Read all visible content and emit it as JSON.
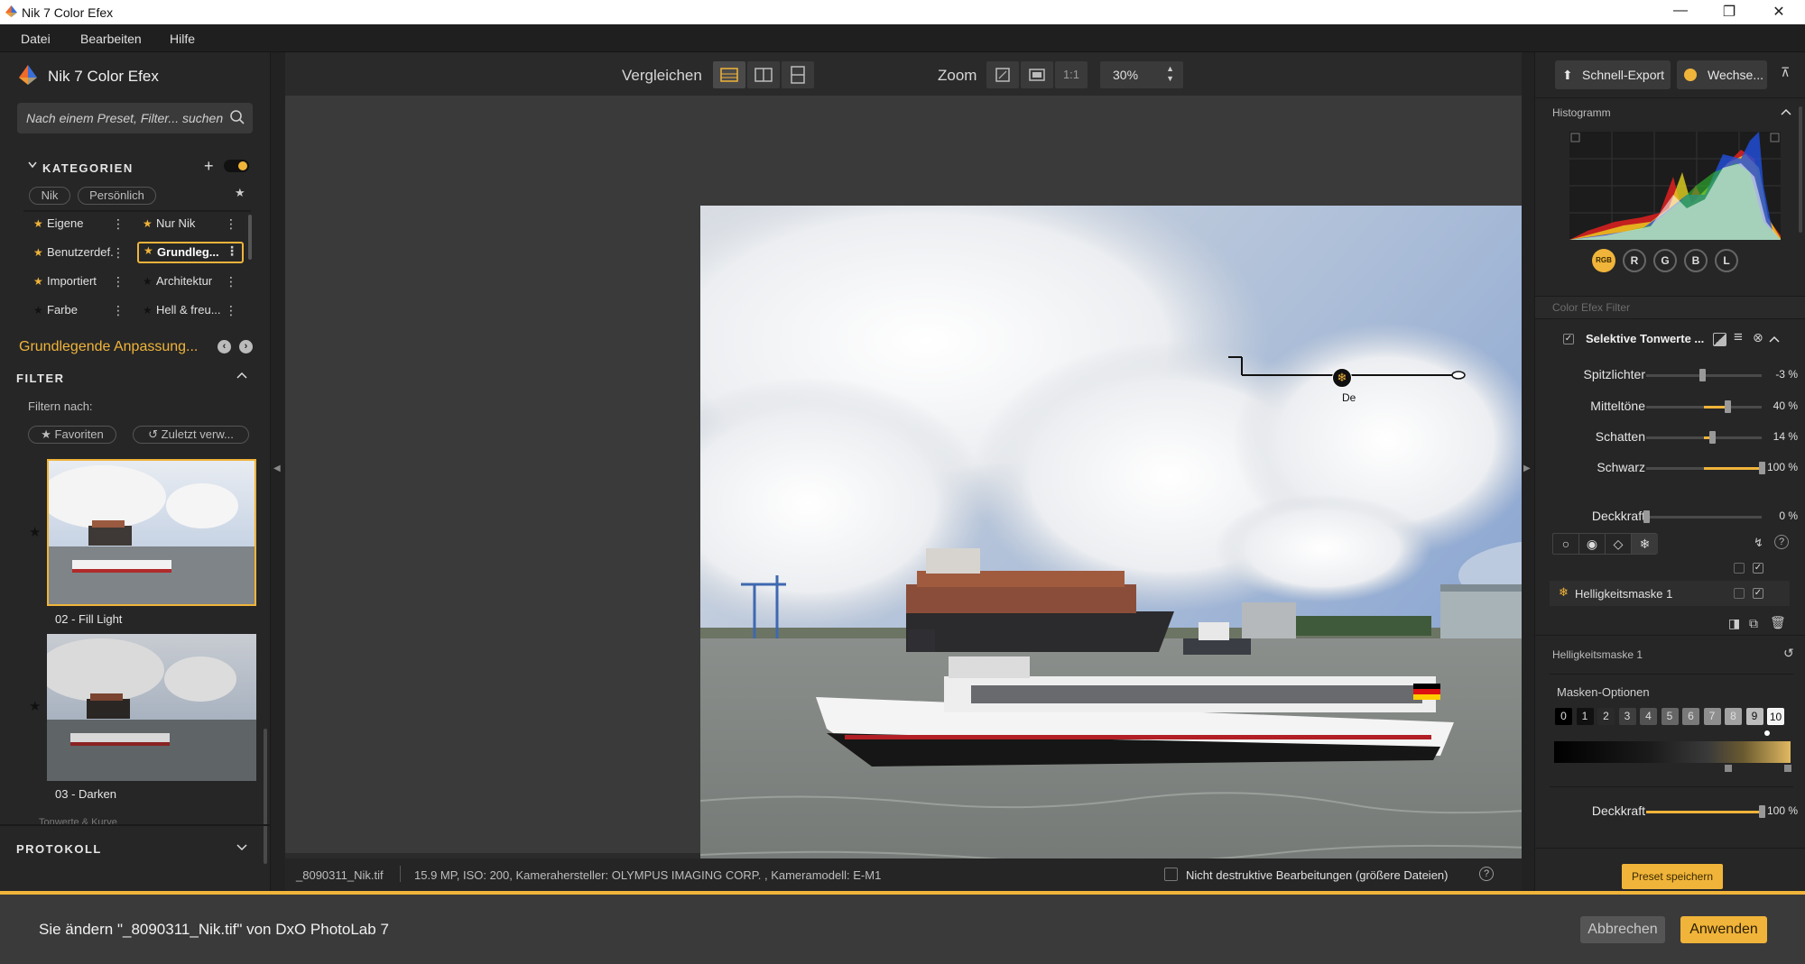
{
  "window": {
    "title": "Nik 7 Color Efex",
    "controls": [
      "minimize-icon",
      "restore-icon",
      "close-icon"
    ]
  },
  "menu": [
    "Datei",
    "Bearbeiten",
    "Hilfe"
  ],
  "left": {
    "brand": "Nik 7 Color Efex",
    "search_placeholder": "Nach einem Preset, Filter... suchen",
    "kategorien_label": "KATEGORIEN",
    "chips": [
      "Nik",
      "Persönlich"
    ],
    "categories": [
      {
        "label": "Eigene",
        "starred": true
      },
      {
        "label": "Nur Nik",
        "starred": true
      },
      {
        "label": "Benutzerdef.",
        "starred": true
      },
      {
        "label": "Grundleg...",
        "starred": true,
        "selected": true
      },
      {
        "label": "Importiert",
        "starred": true
      },
      {
        "label": "Architektur",
        "starred": false
      },
      {
        "label": "Farbe",
        "starred": false
      },
      {
        "label": "Hell & freu...",
        "starred": false
      }
    ],
    "active_category": "Grundlegende Anpassung...",
    "filter_label": "FILTER",
    "filter_by": "Filtern nach:",
    "filter_chips": [
      "Favoriten",
      "Zuletzt verw..."
    ],
    "presets": [
      {
        "label": "02 - Fill Light",
        "selected": true
      },
      {
        "label": "03 - Darken",
        "selected": false
      }
    ],
    "truncated_item": "Tonwerte & Kurve",
    "protokoll_label": "PROTOKOLL"
  },
  "toolbar": {
    "compare_label": "Vergleichen",
    "zoom_label": "Zoom",
    "zoom_1to1": "1:1",
    "zoom_value": "30%"
  },
  "canvas": {
    "control_point_label": "De"
  },
  "status": {
    "filename": "_8090311_Nik.tif",
    "meta": "15.9 MP, ISO: 200, Kamerahersteller: OLYMPUS IMAGING CORP.  , Kameramodell: E-M1",
    "nondestructive_label": "Nicht destruktive Bearbeitungen (größere Dateien)"
  },
  "right": {
    "quick_export": "Schnell-Export",
    "switch": "Wechse...",
    "histogram_label": "Histogramm",
    "channels": [
      "RGB",
      "R",
      "G",
      "B",
      "L"
    ],
    "filter_section_label": "Color Efex Filter",
    "filter_name": "Selektive Tonwerte ...",
    "sliders": [
      {
        "name": "Spitzlichter",
        "value": "-3 %",
        "pos": -3
      },
      {
        "name": "Mitteltöne",
        "value": "40 %",
        "pos": 40
      },
      {
        "name": "Schatten",
        "value": "14 %",
        "pos": 14
      },
      {
        "name": "Schwarz",
        "value": "100 %",
        "pos": 100
      }
    ],
    "opacity": {
      "name": "Deckkraft",
      "value": "0 %",
      "pos": 0
    },
    "mask_name": "Helligkeitsmaske 1",
    "mask_section_label": "Helligkeitsmaske 1",
    "mask_options_label": "Masken-Optionen",
    "mask_numbers": [
      "0",
      "1",
      "2",
      "3",
      "4",
      "5",
      "6",
      "7",
      "8",
      "9",
      "10"
    ],
    "mask_opacity": {
      "name": "Deckkraft",
      "value": "100 %",
      "pos": 100
    },
    "save_preset": "Preset speichern"
  },
  "bottom": {
    "message": "Sie ändern \"_8090311_Nik.tif\" von DxO PhotoLab 7",
    "cancel": "Abbrechen",
    "apply": "Anwenden"
  },
  "colors": {
    "accent": "#f0b43a",
    "panel": "#262626",
    "canvas": "#3a3a3a"
  }
}
